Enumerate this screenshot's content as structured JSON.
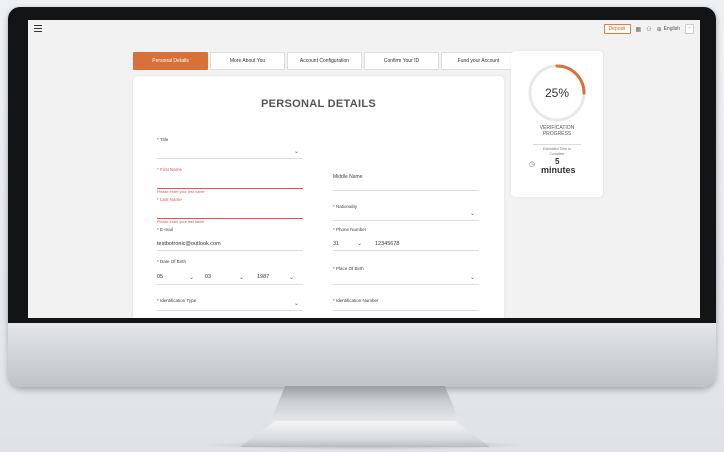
{
  "header": {
    "deposit_label": "Deposit",
    "language_label": "English"
  },
  "tabs": [
    {
      "label": "Personal Details",
      "active": true
    },
    {
      "label": "More About You",
      "active": false
    },
    {
      "label": "Account Configuration",
      "active": false
    },
    {
      "label": "Confirm Your ID",
      "active": false
    },
    {
      "label": "Fund your Account",
      "active": false
    }
  ],
  "form": {
    "title": "PERSONAL DETAILS",
    "title_field": {
      "label": "* Title",
      "value": ""
    },
    "first_name": {
      "label": "* First Name",
      "value": "",
      "error": "Please enter your first name"
    },
    "middle_name": {
      "label": "Middle Name",
      "value": ""
    },
    "last_name": {
      "label": "* Last Name",
      "value": "",
      "error": "Please enter your last name"
    },
    "nationality": {
      "label": "* Nationality",
      "value": ""
    },
    "email": {
      "label": "* E-mail",
      "value": "testbotronic@outlook.com"
    },
    "phone": {
      "label": "* Phone Number",
      "code": "31",
      "number": "12345678"
    },
    "dob": {
      "label": "* Date Of Birth",
      "day": "05",
      "month": "03",
      "year": "1987"
    },
    "place_of_birth": {
      "label": "* Place Of Birth",
      "value": ""
    },
    "id_type": {
      "label": "* Identification Type",
      "value": ""
    },
    "id_number": {
      "label": "* Identification Number",
      "value": ""
    }
  },
  "progress": {
    "percent_text": "25%",
    "fraction": 0.25,
    "title_line1": "VERIFICATION",
    "title_line2": "PROGRESS",
    "estimated_line1": "Estimated Time to",
    "estimated_line2": "Complete",
    "minutes_value": "5",
    "minutes_label": "minutes"
  },
  "colors": {
    "accent": "#d8703a",
    "error": "#e25353"
  }
}
